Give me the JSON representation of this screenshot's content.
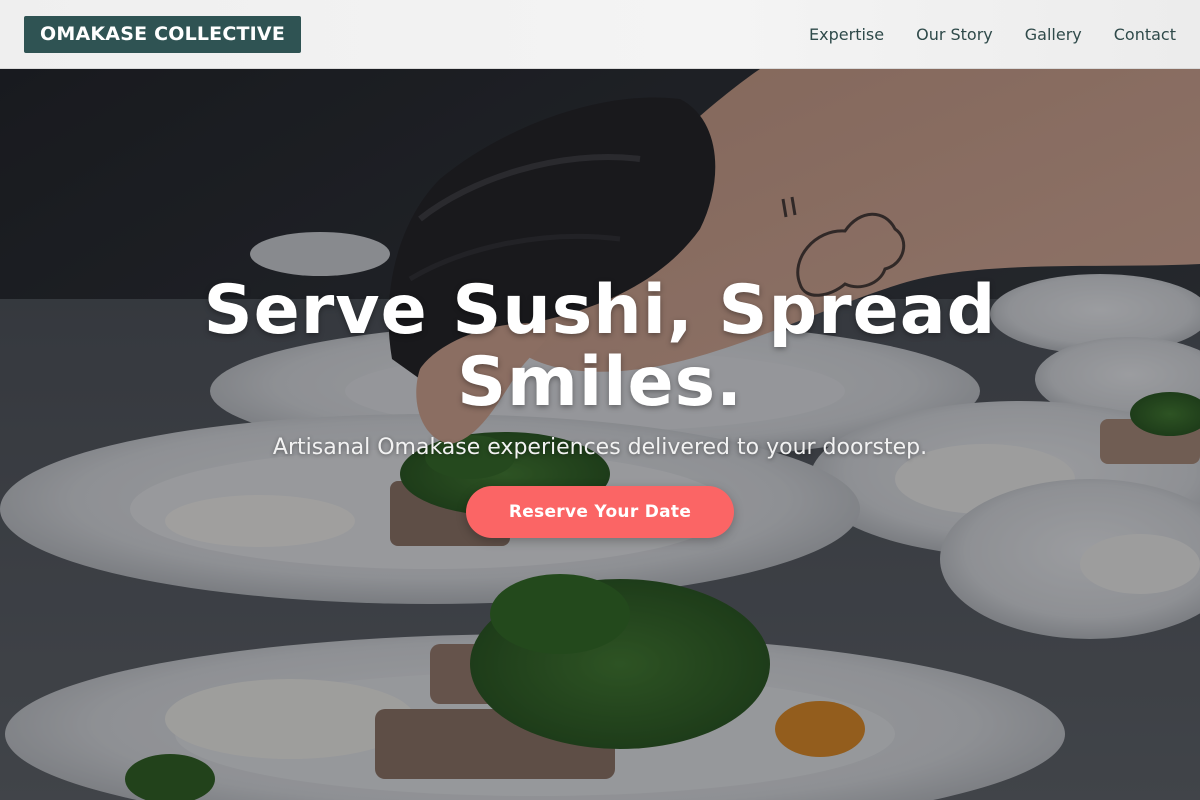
{
  "header": {
    "logo": "OMAKASE COLLECTIVE",
    "nav": [
      {
        "label": "Expertise"
      },
      {
        "label": "Our Story"
      },
      {
        "label": "Gallery"
      },
      {
        "label": "Contact"
      }
    ]
  },
  "hero": {
    "title": "Serve Sushi, Spread Smiles.",
    "subtitle": "Artisanal Omakase experiences delivered to your doorstep.",
    "cta_label": "Reserve Your Date",
    "background_image": "chef-gloved-hand-plating-dishes-photo"
  },
  "colors": {
    "logo_bg": "#2f5353",
    "nav_text": "#2f4a4a",
    "cta_bg": "#fb6565",
    "header_bg": "#f2f2f2"
  }
}
